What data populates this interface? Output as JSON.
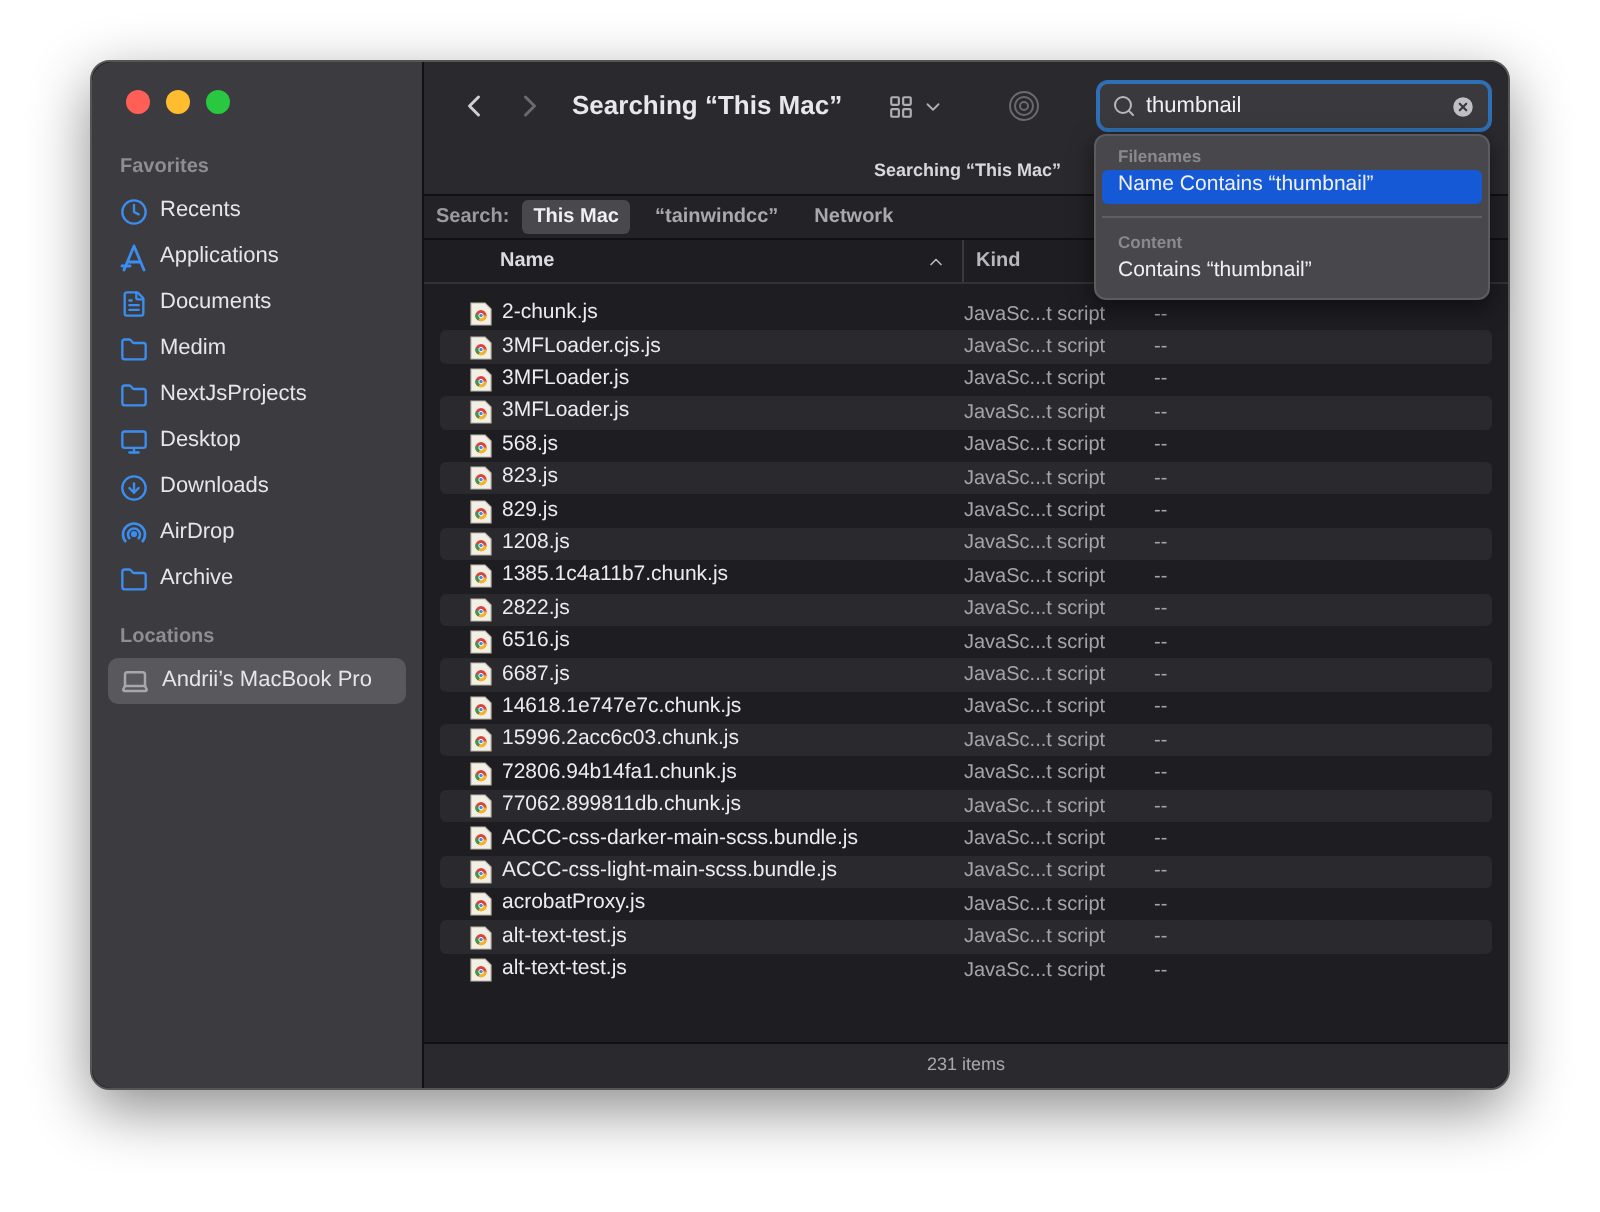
{
  "sidebar": {
    "sections": [
      {
        "title": "Favorites",
        "items": [
          {
            "label": "Recents",
            "kind": "recents",
            "selected": false
          },
          {
            "label": "Applications",
            "kind": "applications",
            "selected": false
          },
          {
            "label": "Documents",
            "kind": "documents",
            "selected": false
          },
          {
            "label": "Medim",
            "kind": "folder",
            "selected": false
          },
          {
            "label": "NextJsProjects",
            "kind": "folder",
            "selected": false
          },
          {
            "label": "Desktop",
            "kind": "desktop",
            "selected": false
          },
          {
            "label": "Downloads",
            "kind": "downloads",
            "selected": false
          },
          {
            "label": "AirDrop",
            "kind": "airdrop",
            "selected": false
          },
          {
            "label": "Archive",
            "kind": "folder",
            "selected": false
          }
        ]
      },
      {
        "title": "Locations",
        "items": [
          {
            "label": "Andrii’s MacBook Pro",
            "kind": "laptop",
            "selected": true
          }
        ]
      }
    ]
  },
  "toolbar": {
    "title": "Searching “This Mac”",
    "subtitle": "Searching “This Mac”",
    "search": {
      "value": "thumbnail"
    }
  },
  "search_menu": {
    "sections": [
      {
        "title": "Filenames",
        "items": [
          {
            "label": "Name Contains “thumbnail”",
            "selected": true
          }
        ]
      },
      {
        "title": "Content",
        "items": [
          {
            "label": "Contains “thumbnail”",
            "selected": false
          }
        ]
      }
    ]
  },
  "scope_bar": {
    "label": "Search:",
    "scopes": [
      {
        "label": "This Mac",
        "selected": true
      },
      {
        "label": "“tainwindcc”",
        "selected": false
      },
      {
        "label": "Network",
        "selected": false
      }
    ]
  },
  "table": {
    "columns": [
      {
        "label": "Name",
        "sorted": true
      },
      {
        "label": "Kind",
        "sorted": false
      }
    ],
    "rows": [
      {
        "name": "2-chunk.js",
        "kind": "JavaSc...t script",
        "column_3": "--"
      },
      {
        "name": "3MFLoader.cjs.js",
        "kind": "JavaSc...t script",
        "column_3": "--"
      },
      {
        "name": "3MFLoader.js",
        "kind": "JavaSc...t script",
        "column_3": "--"
      },
      {
        "name": "3MFLoader.js",
        "kind": "JavaSc...t script",
        "column_3": "--"
      },
      {
        "name": "568.js",
        "kind": "JavaSc...t script",
        "column_3": "--"
      },
      {
        "name": "823.js",
        "kind": "JavaSc...t script",
        "column_3": "--"
      },
      {
        "name": "829.js",
        "kind": "JavaSc...t script",
        "column_3": "--"
      },
      {
        "name": "1208.js",
        "kind": "JavaSc...t script",
        "column_3": "--"
      },
      {
        "name": "1385.1c4a11b7.chunk.js",
        "kind": "JavaSc...t script",
        "column_3": "--"
      },
      {
        "name": "2822.js",
        "kind": "JavaSc...t script",
        "column_3": "--"
      },
      {
        "name": "6516.js",
        "kind": "JavaSc...t script",
        "column_3": "--"
      },
      {
        "name": "6687.js",
        "kind": "JavaSc...t script",
        "column_3": "--"
      },
      {
        "name": "14618.1e747e7c.chunk.js",
        "kind": "JavaSc...t script",
        "column_3": "--"
      },
      {
        "name": "15996.2acc6c03.chunk.js",
        "kind": "JavaSc...t script",
        "column_3": "--"
      },
      {
        "name": "72806.94b14fa1.chunk.js",
        "kind": "JavaSc...t script",
        "column_3": "--"
      },
      {
        "name": "77062.899811db.chunk.js",
        "kind": "JavaSc...t script",
        "column_3": "--"
      },
      {
        "name": "ACCC-css-darker-main-scss.bundle.js",
        "kind": "JavaSc...t script",
        "column_3": "--"
      },
      {
        "name": "ACCC-css-light-main-scss.bundle.js",
        "kind": "JavaSc...t script",
        "column_3": "--"
      },
      {
        "name": "acrobatProxy.js",
        "kind": "JavaSc...t script",
        "column_3": "--"
      },
      {
        "name": "alt-text-test.js",
        "kind": "JavaSc...t script",
        "column_3": "--"
      },
      {
        "name": "alt-text-test.js",
        "kind": "JavaSc...t script",
        "column_3": "--"
      }
    ]
  },
  "status_bar": {
    "text": "231 items"
  }
}
